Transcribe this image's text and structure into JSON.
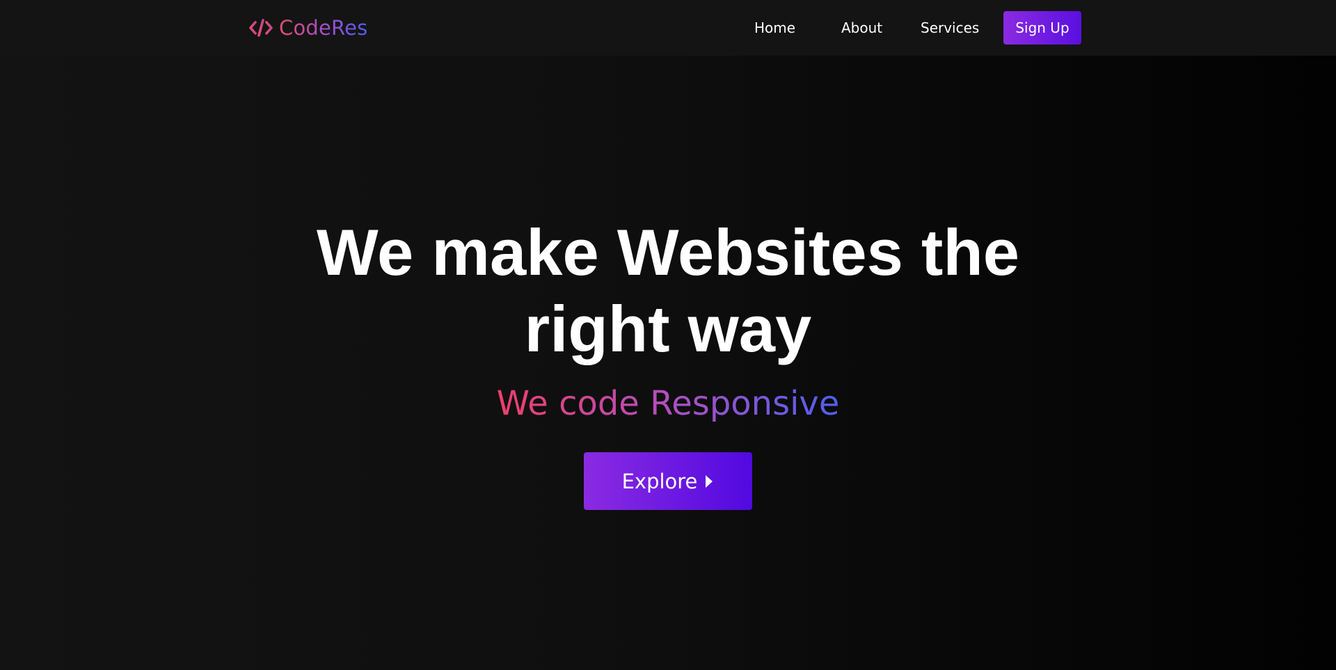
{
  "brand": {
    "name": "CodeRes",
    "icon": "code-icon"
  },
  "nav": {
    "items": [
      {
        "label": "Home"
      },
      {
        "label": "About"
      },
      {
        "label": "Services"
      }
    ],
    "cta_label": "Sign Up"
  },
  "hero": {
    "title": "We make Websites the right way",
    "subtitle": "We code Responsive",
    "button_label": "Explore",
    "button_icon": "caret-right-icon"
  },
  "colors": {
    "background": "#0f0f0f",
    "accent_start": "#8a2be2",
    "accent_end": "#5209e0",
    "gradient_text_start": "#ee3f6a",
    "gradient_text_end": "#4f5ff0"
  }
}
